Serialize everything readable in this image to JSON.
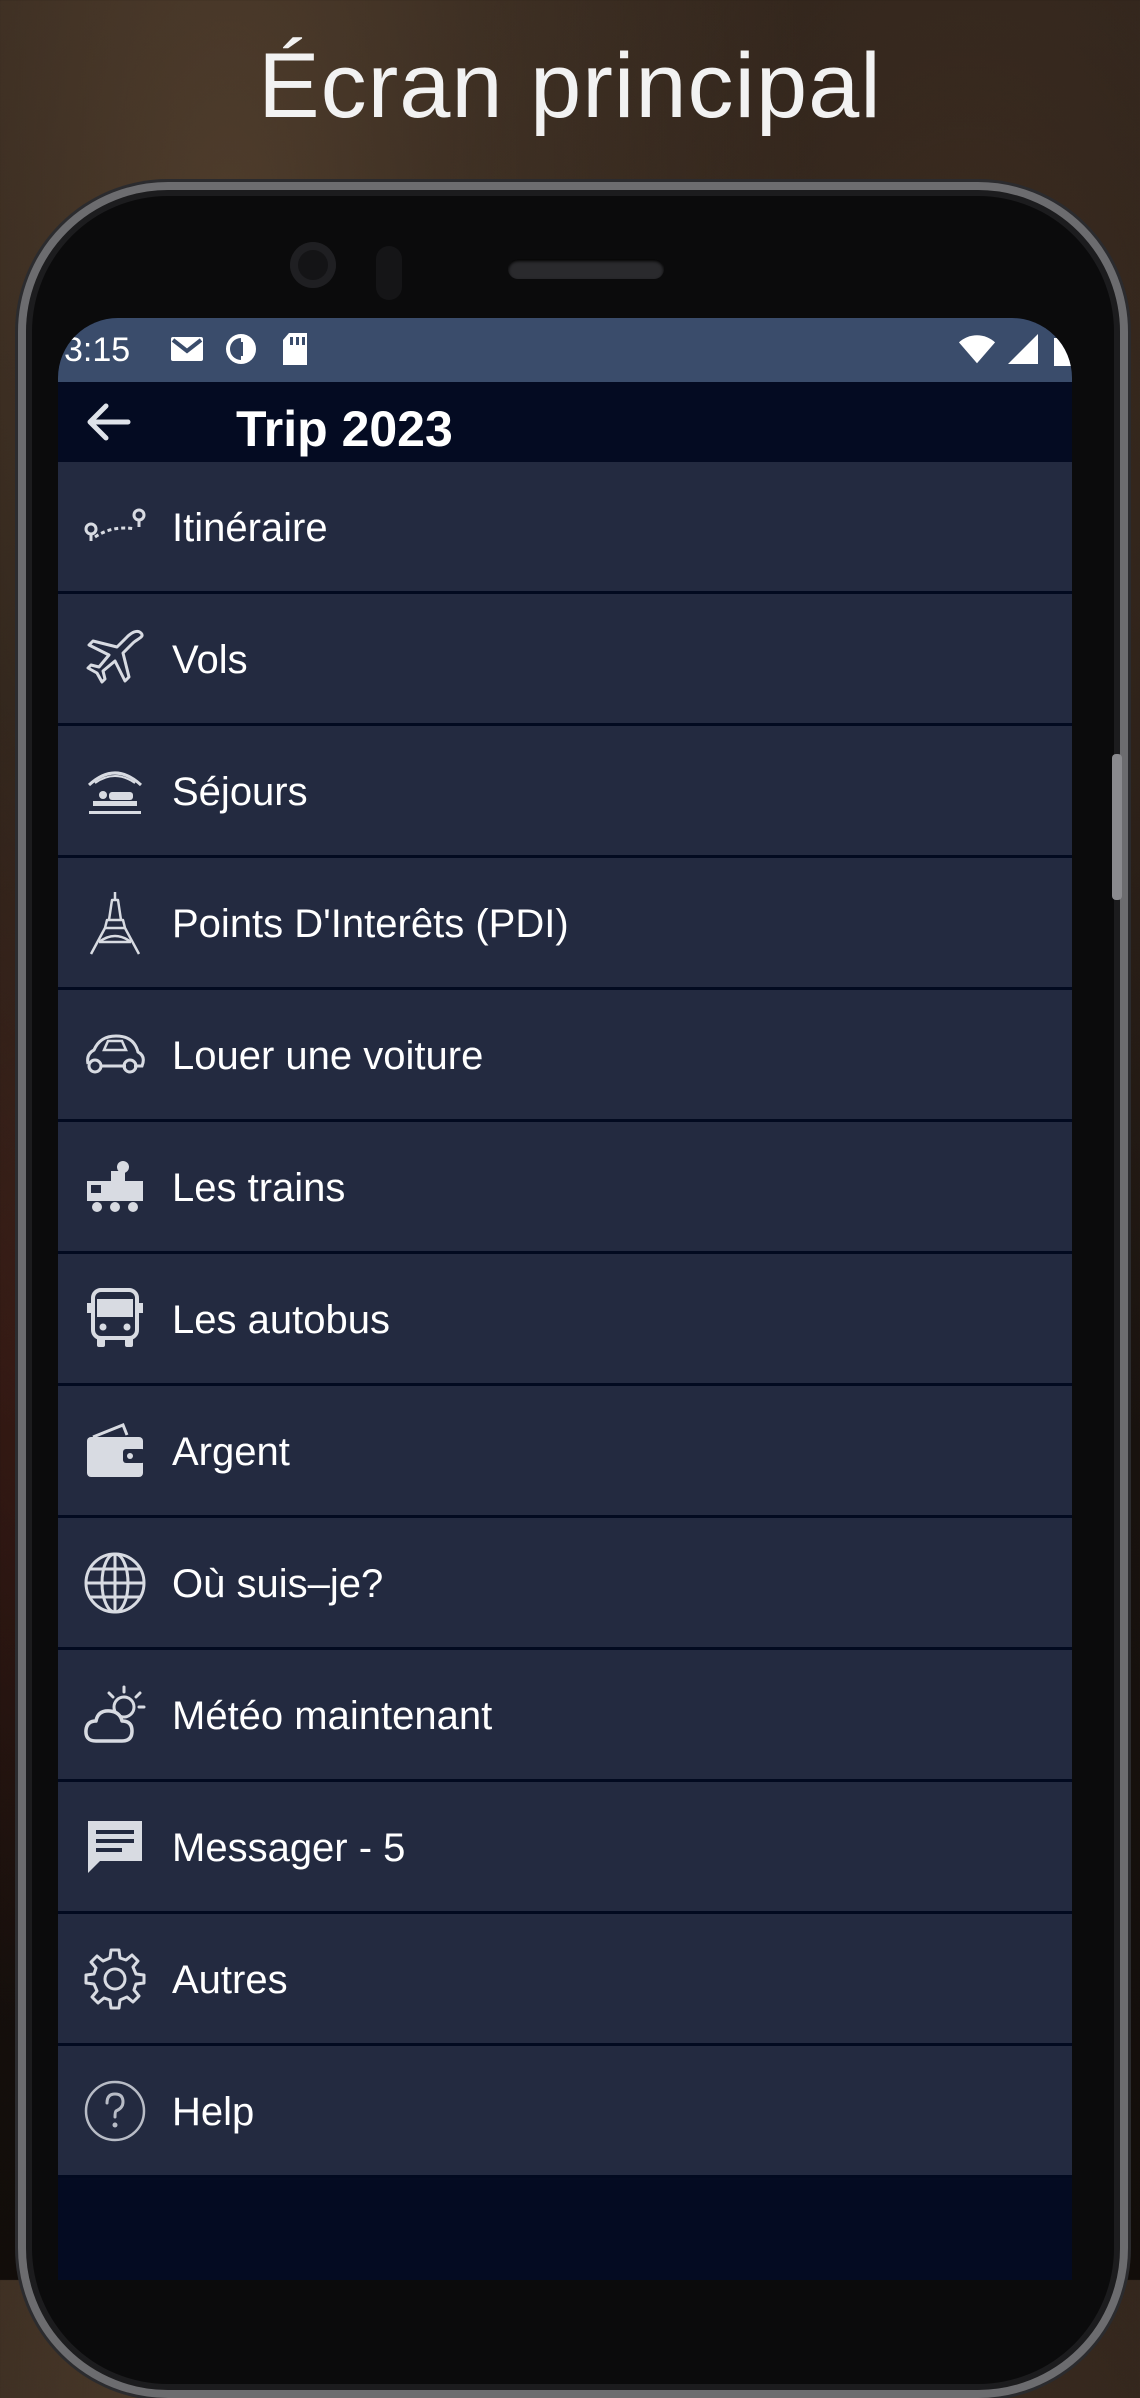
{
  "headline": "Écran principal",
  "status_bar": {
    "time": "3:15",
    "icons_left": [
      "mail-icon",
      "circle-half-icon",
      "sd-card-icon"
    ],
    "icons_right": [
      "wifi-icon",
      "signal-icon",
      "battery-icon"
    ]
  },
  "app_bar": {
    "title": "Trip 2023",
    "back_icon": "arrow-left-icon"
  },
  "menu": {
    "items": [
      {
        "label": "Itinéraire",
        "icon": "route-icon"
      },
      {
        "label": "Vols",
        "icon": "airplane-icon"
      },
      {
        "label": "Séjours",
        "icon": "hotel-icon"
      },
      {
        "label": "Points D'Interêts (PDI)",
        "icon": "eiffel-tower-icon"
      },
      {
        "label": "Louer une voiture",
        "icon": "car-icon"
      },
      {
        "label": "Les trains",
        "icon": "train-icon"
      },
      {
        "label": "Les autobus",
        "icon": "bus-icon"
      },
      {
        "label": "Argent",
        "icon": "wallet-icon"
      },
      {
        "label": "Où suis–je?",
        "icon": "globe-icon"
      },
      {
        "label": "Météo maintenant",
        "icon": "weather-icon"
      },
      {
        "label": "Messager - 5",
        "icon": "message-icon"
      },
      {
        "label": "Autres",
        "icon": "gear-icon"
      },
      {
        "label": "Help",
        "icon": "help-icon"
      }
    ]
  },
  "colors": {
    "status_bar": "#3a4c6b",
    "app_bar": "#040b22",
    "menu_item": "#232a40",
    "text": "#ffffff",
    "icon": "#d8dbe2"
  }
}
